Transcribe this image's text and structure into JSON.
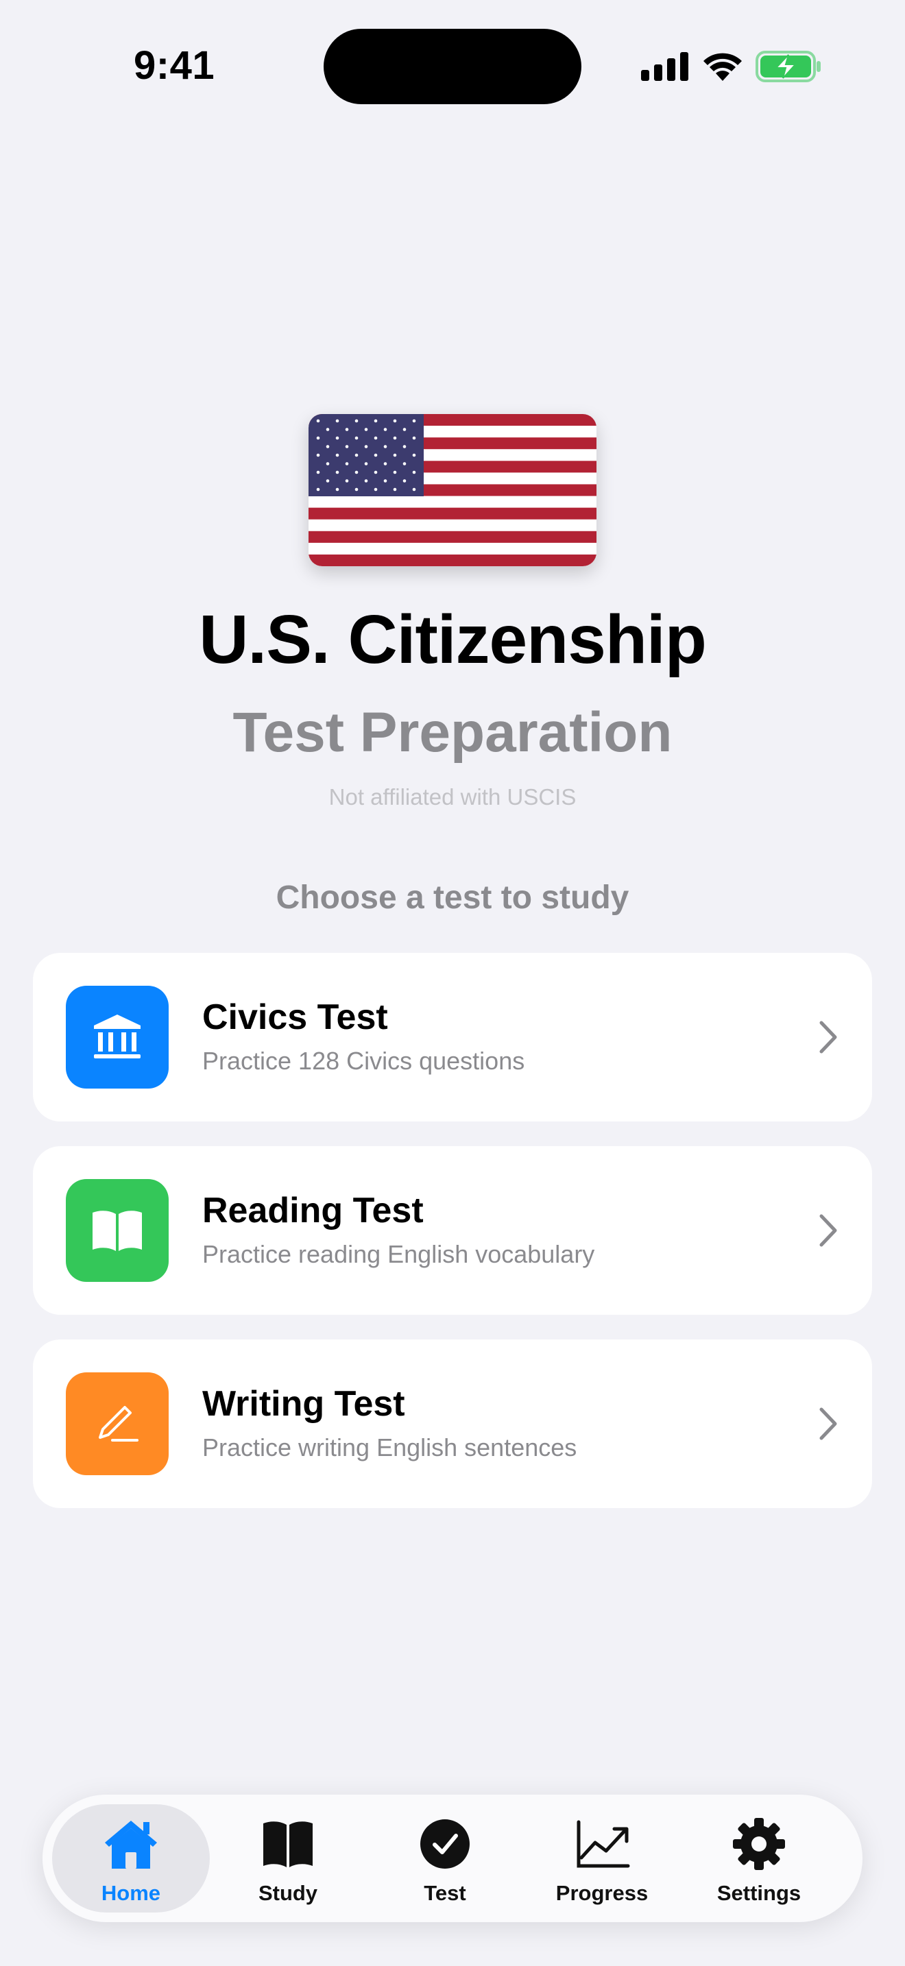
{
  "status_bar": {
    "time": "9:41"
  },
  "hero": {
    "title": "U.S. Citizenship",
    "subtitle": "Test Preparation",
    "disclaimer": "Not affiliated with USCIS",
    "prompt": "Choose a test to study"
  },
  "tests": [
    {
      "title": "Civics Test",
      "subtitle": "Practice 128 Civics questions",
      "icon": "building-columns-icon",
      "color": "#0a84ff"
    },
    {
      "title": "Reading Test",
      "subtitle": "Practice reading English vocabulary",
      "icon": "book-icon",
      "color": "#34c759"
    },
    {
      "title": "Writing Test",
      "subtitle": "Practice writing English sentences",
      "icon": "pencil-line-icon",
      "color": "#ff8a24"
    }
  ],
  "tabbar": {
    "items": [
      {
        "label": "Home",
        "icon": "house-icon",
        "active": true
      },
      {
        "label": "Study",
        "icon": "book-icon",
        "active": false
      },
      {
        "label": "Test",
        "icon": "checkmark-circle-icon",
        "active": false
      },
      {
        "label": "Progress",
        "icon": "chart-line-icon",
        "active": false
      },
      {
        "label": "Settings",
        "icon": "gear-icon",
        "active": false
      }
    ]
  },
  "colors": {
    "accent": "#0a84ff",
    "background": "#f2f2f7",
    "battery": "#34c759"
  }
}
